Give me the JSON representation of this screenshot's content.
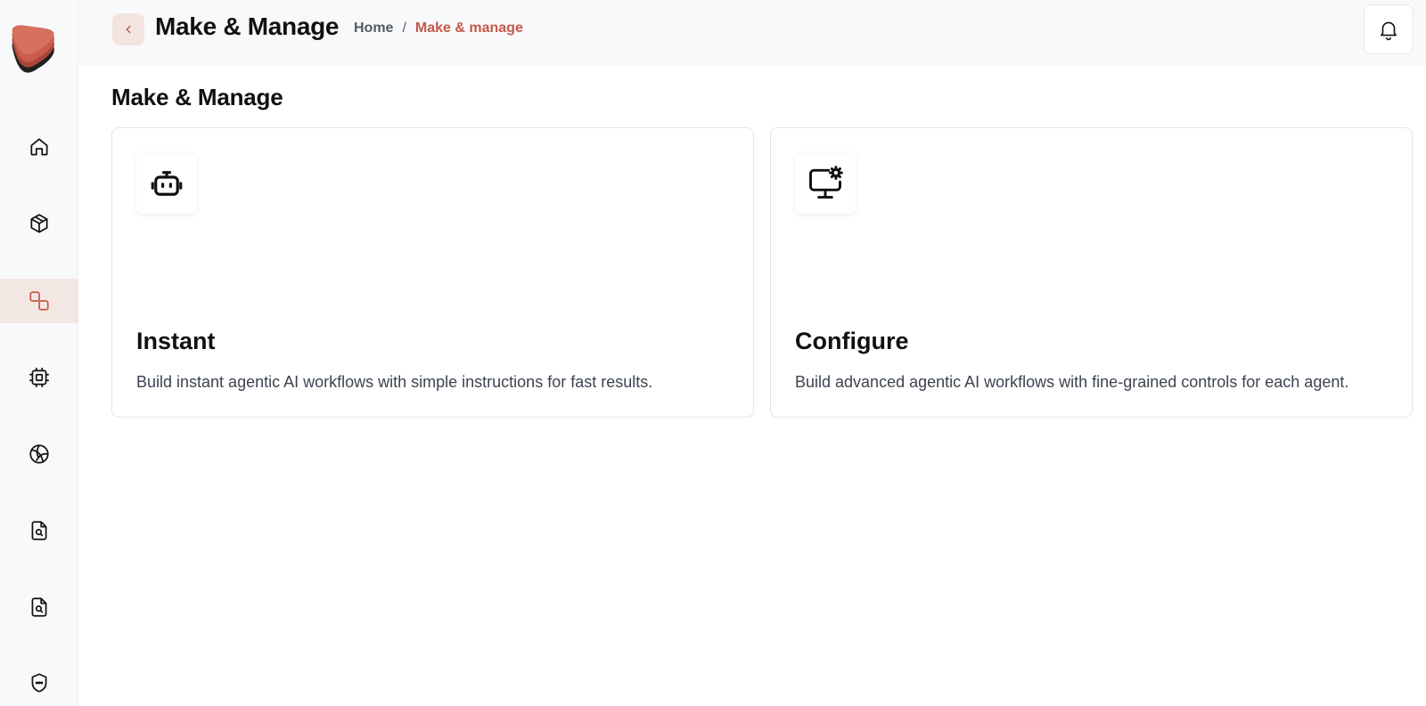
{
  "header": {
    "title": "Make & Manage",
    "breadcrumb": {
      "home": "Home",
      "separator": "/",
      "current": "Make & manage"
    }
  },
  "main": {
    "page_title": "Make & Manage",
    "cards": [
      {
        "title": "Instant",
        "description": "Build instant agentic AI workflows with simple instructions for fast results.",
        "icon": "robot-icon"
      },
      {
        "title": "Configure",
        "description": "Build advanced agentic AI workflows with fine-grained controls for each agent.",
        "icon": "monitor-gear-icon"
      }
    ]
  },
  "sidebar": {
    "items": [
      {
        "icon": "home-icon",
        "active": false
      },
      {
        "icon": "cube-icon",
        "active": false
      },
      {
        "icon": "make-manage-icon",
        "active": true
      },
      {
        "icon": "chip-icon",
        "active": false
      },
      {
        "icon": "ball-icon",
        "active": false
      },
      {
        "icon": "file-search-icon",
        "active": false
      },
      {
        "icon": "file-search-icon",
        "active": false
      },
      {
        "icon": "shield-icon",
        "active": false
      }
    ]
  },
  "colors": {
    "accent": "#c5574a",
    "active_bg": "#f3e7e4",
    "sidebar_bg": "#f8f9fb"
  }
}
